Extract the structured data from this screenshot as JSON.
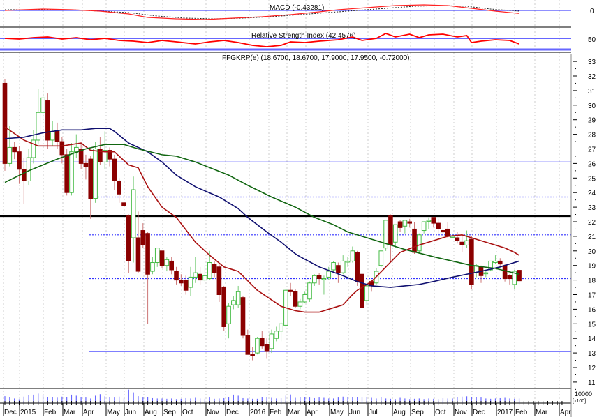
{
  "chart_data": {
    "type": "candlestick",
    "symbol_title": "FFGKRP(e) (18.6700, 18.6700, 17.9000, 17.9500, -0.72000)",
    "macd_title": "MACD (-0.43281)",
    "rsi_title": "Relative Strength Index (42.4576)",
    "macd_zero_label": "0",
    "rsi_mid_label": "50",
    "volume_label": "10000",
    "volume_unit": "[x100]",
    "ylim": [
      11,
      33
    ],
    "y_ticks": [
      "11",
      "12",
      "13",
      "14",
      "15",
      "16",
      "17",
      "18",
      "19",
      "20",
      "21",
      "22",
      "23",
      "24",
      "25",
      "26",
      "27",
      "28",
      "29",
      "30",
      "31",
      "32",
      "33"
    ],
    "x_labels": [
      "Dec",
      "2015",
      "Feb",
      "Mar",
      "Apr",
      "May",
      "Jun",
      "Aug",
      "Sep",
      "Oct",
      "Nov",
      "Dec",
      "2016",
      "Feb",
      "Mar",
      "Apr",
      "May",
      "Jun",
      "Jul",
      "Aug",
      "Sep",
      "Oct",
      "Nov",
      "Dec",
      "2017",
      "Feb",
      "Mar",
      "Apr"
    ],
    "horizontal_lines": [
      {
        "value": 22.4,
        "color": "#000000",
        "style": "solid-thick"
      },
      {
        "value": 26.1,
        "color": "#3333ff",
        "style": "solid"
      },
      {
        "value": 23.7,
        "color": "#3333ff",
        "style": "dotted"
      },
      {
        "value": 21.1,
        "color": "#3333ff",
        "style": "dotted"
      },
      {
        "value": 18.1,
        "color": "#3333ff",
        "style": "dotted"
      },
      {
        "value": 13.1,
        "color": "#3333ff",
        "style": "solid"
      }
    ],
    "colors": {
      "up": "#44bb44",
      "down": "#8b0000",
      "ma_short": "#aa1111",
      "ma_mid": "#101070",
      "ma_long": "#116611",
      "macd": "#ff2222",
      "rsi": "#ff0000",
      "volume": "#6666ff"
    },
    "ohlc": [
      [
        31.5,
        31.8,
        25.5,
        26.0
      ],
      [
        26.0,
        28.6,
        25.8,
        27.1
      ],
      [
        27.1,
        27.5,
        26.3,
        26.8
      ],
      [
        26.8,
        27.2,
        24.6,
        25.6
      ],
      [
        25.6,
        26.4,
        23.2,
        24.8
      ],
      [
        24.8,
        27.0,
        24.5,
        26.4
      ],
      [
        26.4,
        28.3,
        26.0,
        27.6
      ],
      [
        27.6,
        31.1,
        27.3,
        29.5
      ],
      [
        29.5,
        31.6,
        29.0,
        30.5
      ],
      [
        30.3,
        30.8,
        27.0,
        27.6
      ],
      [
        27.6,
        28.9,
        27.2,
        28.2
      ],
      [
        28.2,
        28.8,
        27.0,
        27.5
      ],
      [
        27.5,
        27.8,
        26.0,
        26.6
      ],
      [
        26.6,
        27.0,
        23.8,
        24.0
      ],
      [
        24.0,
        27.4,
        23.8,
        26.8
      ],
      [
        26.8,
        28.0,
        26.4,
        27.1
      ],
      [
        27.0,
        27.4,
        25.6,
        26.0
      ],
      [
        26.0,
        26.6,
        24.9,
        25.8
      ],
      [
        26.3,
        26.5,
        22.2,
        23.6
      ],
      [
        23.6,
        27.5,
        23.3,
        27.0
      ],
      [
        27.0,
        27.8,
        25.9,
        26.1
      ],
      [
        26.1,
        28.2,
        25.6,
        26.9
      ],
      [
        26.9,
        27.1,
        25.8,
        26.3
      ],
      [
        26.3,
        26.6,
        24.2,
        24.8
      ],
      [
        24.8,
        25.0,
        23.3,
        23.9
      ],
      [
        23.3,
        23.6,
        22.9,
        23.1
      ],
      [
        22.4,
        22.5,
        18.5,
        19.3
      ],
      [
        20.9,
        25.1,
        19.2,
        24.2
      ],
      [
        20.9,
        22.7,
        18.5,
        18.6
      ],
      [
        21.4,
        21.9,
        20.2,
        20.4
      ],
      [
        21.2,
        21.3,
        15.0,
        18.4
      ],
      [
        18.6,
        19.6,
        18.4,
        19.2
      ],
      [
        19.2,
        20.0,
        18.9,
        20.2
      ],
      [
        20.0,
        20.0,
        18.8,
        19.0
      ],
      [
        19.0,
        19.6,
        18.6,
        19.4
      ],
      [
        19.3,
        19.6,
        18.4,
        18.7
      ],
      [
        18.6,
        18.9,
        17.7,
        18.0
      ],
      [
        18.0,
        18.4,
        17.6,
        17.8
      ],
      [
        18.0,
        18.3,
        17.0,
        17.3
      ],
      [
        17.5,
        18.9,
        16.9,
        18.2
      ],
      [
        18.2,
        19.6,
        17.8,
        18.5
      ],
      [
        18.4,
        18.9,
        17.7,
        18.0
      ],
      [
        18.0,
        19.0,
        17.9,
        18.3
      ],
      [
        18.1,
        20.0,
        18.0,
        19.2
      ],
      [
        19.1,
        19.3,
        18.2,
        18.5
      ],
      [
        18.9,
        19.1,
        16.5,
        17.0
      ],
      [
        17.5,
        17.6,
        14.5,
        14.8
      ],
      [
        15.0,
        16.4,
        14.0,
        16.2
      ],
      [
        16.3,
        16.9,
        16.0,
        16.6
      ],
      [
        16.3,
        17.6,
        16.1,
        17.2
      ],
      [
        16.8,
        16.9,
        14.0,
        14.2
      ],
      [
        14.2,
        14.6,
        12.9,
        12.9
      ],
      [
        12.9,
        13.4,
        12.5,
        12.8
      ],
      [
        13.0,
        14.1,
        12.9,
        14.0
      ],
      [
        14.0,
        14.5,
        13.3,
        13.5
      ],
      [
        13.6,
        14.0,
        12.6,
        13.1
      ],
      [
        13.3,
        14.6,
        13.0,
        14.3
      ],
      [
        14.0,
        14.8,
        13.8,
        14.5
      ],
      [
        14.5,
        15.1,
        13.8,
        15.0
      ],
      [
        14.9,
        17.4,
        14.8,
        17.3
      ],
      [
        17.3,
        17.8,
        16.9,
        17.2
      ],
      [
        17.2,
        17.4,
        16.1,
        16.2
      ],
      [
        16.2,
        16.7,
        16.0,
        16.5
      ],
      [
        16.5,
        17.2,
        16.4,
        17.0
      ],
      [
        16.7,
        17.9,
        16.5,
        17.8
      ],
      [
        17.8,
        18.4,
        17.6,
        18.3
      ],
      [
        18.3,
        18.5,
        17.7,
        18.1
      ],
      [
        18.1,
        18.3,
        17.0,
        18.1
      ],
      [
        18.2,
        18.9,
        18.0,
        18.6
      ],
      [
        18.7,
        19.3,
        18.5,
        19.2
      ],
      [
        19.0,
        19.2,
        17.8,
        18.5
      ],
      [
        18.5,
        19.7,
        18.4,
        19.3
      ],
      [
        19.3,
        19.6,
        18.9,
        19.3
      ],
      [
        19.3,
        20.3,
        19.2,
        20.0
      ],
      [
        19.9,
        20.0,
        17.6,
        17.9
      ],
      [
        18.4,
        18.7,
        15.6,
        16.1
      ],
      [
        16.6,
        17.7,
        16.3,
        17.6
      ],
      [
        17.9,
        18.0,
        17.2,
        17.6
      ],
      [
        17.8,
        18.8,
        17.7,
        18.6
      ],
      [
        19.0,
        20.0,
        18.9,
        20.0
      ],
      [
        20.2,
        22.1,
        20.0,
        22.1
      ],
      [
        22.4,
        22.5,
        19.3,
        20.4
      ],
      [
        20.6,
        21.8,
        20.2,
        21.8
      ],
      [
        22.0,
        22.1,
        21.3,
        21.6
      ],
      [
        21.7,
        22.1,
        21.2,
        22.1
      ],
      [
        22.0,
        22.2,
        21.6,
        21.9
      ],
      [
        21.5,
        22.0,
        19.8,
        19.9
      ],
      [
        20.0,
        21.2,
        19.8,
        21.1
      ],
      [
        21.4,
        22.0,
        21.2,
        22.0
      ],
      [
        22.1,
        22.3,
        21.5,
        22.1
      ],
      [
        22.3,
        22.3,
        21.6,
        21.9
      ],
      [
        21.9,
        22.2,
        21.2,
        21.5
      ],
      [
        21.4,
        21.9,
        21.0,
        21.3
      ],
      [
        21.5,
        22.0,
        20.9,
        21.0
      ],
      [
        21.0,
        21.1,
        20.9,
        21.0
      ],
      [
        20.9,
        21.3,
        20.5,
        20.7
      ],
      [
        20.6,
        21.0,
        19.9,
        20.4
      ],
      [
        20.4,
        21.4,
        20.2,
        20.7
      ],
      [
        20.8,
        21.0,
        17.4,
        17.7
      ],
      [
        18.5,
        19.1,
        18.2,
        19.0
      ],
      [
        18.9,
        19.0,
        17.8,
        18.3
      ],
      [
        18.5,
        18.6,
        18.2,
        18.5
      ],
      [
        18.7,
        19.3,
        18.6,
        19.3
      ],
      [
        19.2,
        19.7,
        19.1,
        19.3
      ],
      [
        19.3,
        19.5,
        19.0,
        19.1
      ],
      [
        19.0,
        19.1,
        17.9,
        18.1
      ],
      [
        18.3,
        18.4,
        17.7,
        18.1
      ],
      [
        17.7,
        18.7,
        17.4,
        18.6
      ],
      [
        18.67,
        18.67,
        17.9,
        17.95
      ]
    ],
    "ma_short": [
      [
        0,
        28.5
      ],
      [
        4,
        27.6
      ],
      [
        7,
        27.2
      ],
      [
        12,
        27.2
      ],
      [
        16,
        27.4
      ],
      [
        18,
        26.9
      ],
      [
        21,
        26.8
      ],
      [
        23,
        26.8
      ],
      [
        26,
        25.9
      ],
      [
        28,
        25.7
      ],
      [
        30,
        24.4
      ],
      [
        33,
        23.0
      ],
      [
        36,
        22.3
      ],
      [
        40,
        20.6
      ],
      [
        43,
        19.7
      ],
      [
        46,
        18.9
      ],
      [
        49,
        18.6
      ],
      [
        53,
        17.3
      ],
      [
        58,
        16.2
      ],
      [
        61,
        15.9
      ],
      [
        63,
        15.8
      ],
      [
        66,
        15.8
      ],
      [
        69,
        16.1
      ],
      [
        71,
        16.3
      ],
      [
        73,
        17.0
      ],
      [
        74,
        17.3
      ],
      [
        77,
        17.9
      ],
      [
        80,
        18.9
      ],
      [
        83,
        19.9
      ],
      [
        87,
        20.4
      ],
      [
        90,
        20.7
      ],
      [
        93,
        21.0
      ],
      [
        96,
        21.1
      ],
      [
        99,
        20.8
      ],
      [
        102,
        20.5
      ],
      [
        105,
        20.2
      ],
      [
        107,
        19.9
      ],
      [
        108,
        19.7
      ]
    ],
    "ma_mid": [
      [
        0,
        27.7
      ],
      [
        4,
        27.8
      ],
      [
        8,
        28.1
      ],
      [
        12,
        28.3
      ],
      [
        16,
        28.3
      ],
      [
        19,
        28.4
      ],
      [
        22,
        28.4
      ],
      [
        23,
        28.2
      ],
      [
        26,
        27.4
      ],
      [
        30,
        26.8
      ],
      [
        33,
        26.1
      ],
      [
        36,
        25.2
      ],
      [
        40,
        24.4
      ],
      [
        45,
        23.7
      ],
      [
        49,
        22.9
      ],
      [
        51,
        22.3
      ],
      [
        55,
        21.3
      ],
      [
        58,
        20.6
      ],
      [
        61,
        19.8
      ],
      [
        62,
        19.6
      ],
      [
        66,
        18.9
      ],
      [
        71,
        18.3
      ],
      [
        74,
        17.9
      ],
      [
        77,
        17.6
      ],
      [
        81,
        17.5
      ],
      [
        84,
        17.6
      ],
      [
        87,
        17.7
      ],
      [
        90,
        17.9
      ],
      [
        94,
        18.2
      ],
      [
        97,
        18.4
      ],
      [
        100,
        18.6
      ],
      [
        104,
        18.9
      ],
      [
        108,
        19.3
      ]
    ],
    "ma_long": [
      [
        0,
        24.7
      ],
      [
        5,
        25.5
      ],
      [
        11,
        26.3
      ],
      [
        17,
        27.0
      ],
      [
        21,
        27.3
      ],
      [
        25,
        27.3
      ],
      [
        28,
        27.0
      ],
      [
        33,
        26.6
      ],
      [
        36,
        26.5
      ],
      [
        40,
        26.1
      ],
      [
        47,
        25.2
      ],
      [
        51,
        24.5
      ],
      [
        56,
        23.7
      ],
      [
        61,
        23.0
      ],
      [
        65,
        22.3
      ],
      [
        69,
        21.8
      ],
      [
        72,
        21.3
      ],
      [
        79,
        20.6
      ],
      [
        84,
        20.1
      ],
      [
        90,
        19.6
      ],
      [
        94,
        19.3
      ],
      [
        98,
        19.0
      ],
      [
        103,
        18.8
      ],
      [
        108,
        18.4
      ]
    ],
    "macd": [
      [
        0,
        0.0
      ],
      [
        8,
        0.2
      ],
      [
        14,
        0.1
      ],
      [
        20,
        -0.1
      ],
      [
        26,
        -0.5
      ],
      [
        30,
        -1.0
      ],
      [
        36,
        -1.2
      ],
      [
        42,
        -1.3
      ],
      [
        48,
        -1.1
      ],
      [
        54,
        -0.9
      ],
      [
        60,
        -0.6
      ],
      [
        66,
        -0.2
      ],
      [
        70,
        0.1
      ],
      [
        76,
        0.4
      ],
      [
        82,
        0.7
      ],
      [
        88,
        0.8
      ],
      [
        93,
        0.7
      ],
      [
        98,
        0.3
      ],
      [
        103,
        -0.1
      ],
      [
        108,
        -0.43
      ]
    ],
    "macd_signal": [
      [
        0,
        0.1
      ],
      [
        8,
        0.1
      ],
      [
        14,
        0.1
      ],
      [
        20,
        -0.1
      ],
      [
        26,
        -0.3
      ],
      [
        32,
        -0.8
      ],
      [
        38,
        -1.1
      ],
      [
        44,
        -1.2
      ],
      [
        50,
        -1.1
      ],
      [
        56,
        -0.9
      ],
      [
        62,
        -0.6
      ],
      [
        68,
        -0.3
      ],
      [
        74,
        0.0
      ],
      [
        80,
        0.3
      ],
      [
        86,
        0.6
      ],
      [
        92,
        0.7
      ],
      [
        97,
        0.6
      ],
      [
        102,
        0.2
      ],
      [
        108,
        -0.1
      ]
    ],
    "rsi": [
      [
        0,
        50
      ],
      [
        3,
        49
      ],
      [
        6,
        51
      ],
      [
        9,
        52
      ],
      [
        12,
        49
      ],
      [
        15,
        51
      ],
      [
        18,
        48
      ],
      [
        21,
        50
      ],
      [
        24,
        47
      ],
      [
        27,
        46
      ],
      [
        30,
        44
      ],
      [
        33,
        47
      ],
      [
        36,
        45
      ],
      [
        40,
        42
      ],
      [
        43,
        45
      ],
      [
        46,
        47
      ],
      [
        49,
        44
      ],
      [
        52,
        40
      ],
      [
        55,
        38
      ],
      [
        58,
        40
      ],
      [
        60,
        45
      ],
      [
        63,
        44
      ],
      [
        66,
        46
      ],
      [
        68,
        47
      ],
      [
        70,
        48
      ],
      [
        73,
        52
      ],
      [
        75,
        47
      ],
      [
        78,
        50
      ],
      [
        80,
        57
      ],
      [
        82,
        52
      ],
      [
        85,
        56
      ],
      [
        87,
        51
      ],
      [
        89,
        55
      ],
      [
        92,
        56
      ],
      [
        95,
        52
      ],
      [
        97,
        54
      ],
      [
        98,
        44
      ],
      [
        100,
        46
      ],
      [
        103,
        48
      ],
      [
        106,
        47
      ],
      [
        108,
        42
      ]
    ],
    "volume": [
      45,
      38,
      30,
      25,
      42,
      50,
      55,
      62,
      50,
      38,
      40,
      35,
      42,
      38,
      55,
      48,
      40,
      36,
      30,
      48,
      58,
      44,
      40,
      36,
      42,
      30,
      88,
      70,
      45,
      36,
      40,
      32,
      30,
      30,
      28,
      30,
      26,
      28,
      32,
      30,
      34,
      30,
      28,
      36,
      28,
      30,
      32,
      40,
      55,
      48,
      32,
      30,
      28,
      28,
      40,
      36,
      34,
      30,
      32,
      48,
      56,
      34,
      38,
      40,
      36,
      32,
      36,
      34,
      30,
      30,
      36,
      42,
      40,
      38,
      40,
      36,
      40,
      34,
      30,
      38,
      30,
      28,
      26,
      34,
      30,
      26,
      28,
      30,
      26,
      30,
      28,
      26,
      32,
      30,
      30,
      38,
      42,
      44,
      40,
      38,
      36,
      30,
      28,
      30,
      32,
      34,
      30,
      28,
      30
    ]
  }
}
